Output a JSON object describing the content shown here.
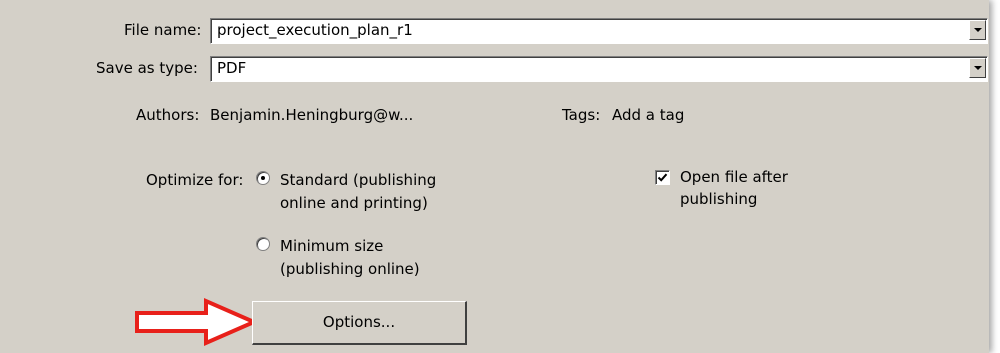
{
  "file_name": {
    "label": "File name:",
    "value": "project_execution_plan_r1"
  },
  "save_as_type": {
    "label": "Save as type:",
    "value": "PDF"
  },
  "authors": {
    "label": "Authors:",
    "value": "Benjamin.Heningburg@w..."
  },
  "tags": {
    "label": "Tags:",
    "value": "Add a tag"
  },
  "optimize": {
    "label": "Optimize for:",
    "standard": {
      "line1": "Standard (publishing",
      "line2": "online and printing)",
      "selected": true
    },
    "minimum": {
      "line1": "Minimum size",
      "line2": "(publishing online)",
      "selected": false
    }
  },
  "open_after": {
    "line1": "Open file after",
    "line2": "publishing",
    "checked": true
  },
  "options_button": {
    "label": "Options..."
  },
  "colors": {
    "panel": "#d4d0c8",
    "arrow": "#e8201a"
  }
}
